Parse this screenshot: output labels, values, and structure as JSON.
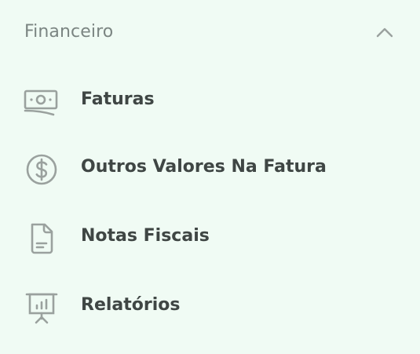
{
  "section": {
    "title": "Financeiro",
    "collapse_icon": "chevron-up-icon"
  },
  "items": [
    {
      "label": "Faturas",
      "icon": "banknote-icon"
    },
    {
      "label": "Outros Valores Na Fatura",
      "icon": "dollar-circle-icon"
    },
    {
      "label": "Notas Fiscais",
      "icon": "document-icon"
    },
    {
      "label": "Relatórios",
      "icon": "presentation-chart-icon"
    }
  ],
  "colors": {
    "background": "#f0fbf4",
    "title_text": "#7b8582",
    "item_text": "#3f4644",
    "icon_stroke": "#9aa19e"
  }
}
